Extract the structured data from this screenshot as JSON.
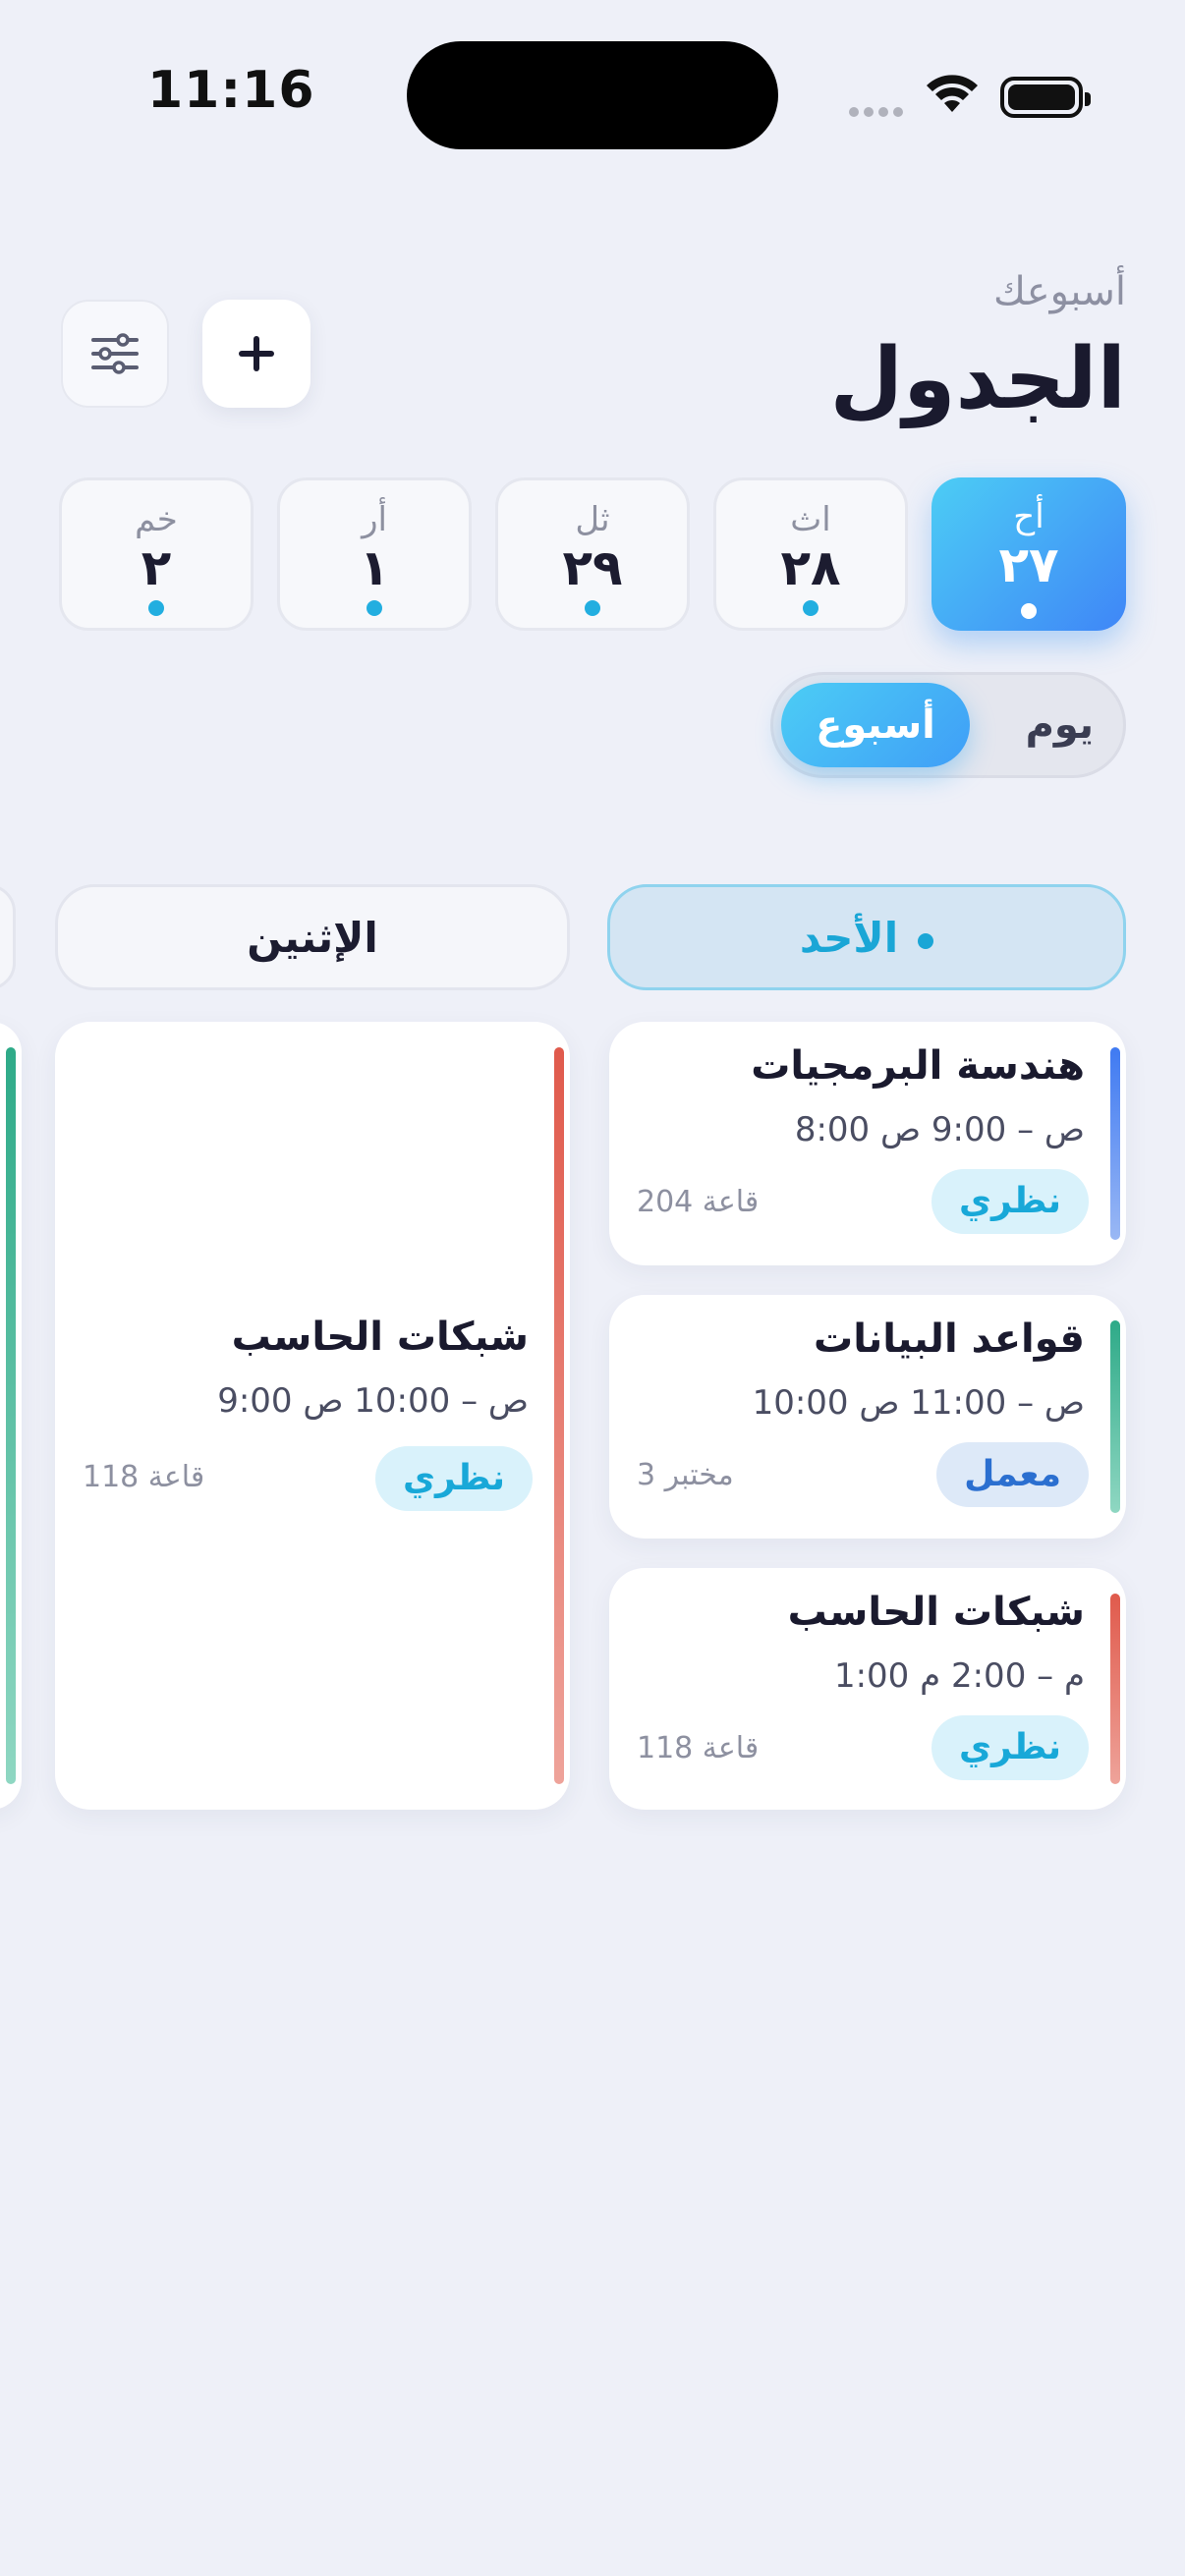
{
  "status_bar": {
    "time": "11:16"
  },
  "header": {
    "kicker": "أسبوعك",
    "title": "الجدول"
  },
  "day_chips": [
    {
      "name": "أح",
      "date": "٢٧",
      "active": true
    },
    {
      "name": "اث",
      "date": "٢٨",
      "active": false
    },
    {
      "name": "ثل",
      "date": "٢٩",
      "active": false
    },
    {
      "name": "أر",
      "date": "١",
      "active": false
    },
    {
      "name": "خم",
      "date": "٢",
      "active": false
    }
  ],
  "view_toggle": {
    "day": "يوم",
    "week": "أسبوع",
    "selected": "week"
  },
  "columns": {
    "sunday": {
      "label": "الأحد"
    },
    "monday": {
      "label": "الإثنين"
    }
  },
  "cards": {
    "sun1": {
      "title": "هندسة البرمجيات",
      "time": "8:00 ص – 9:00 ص",
      "tag": "نظري",
      "room": "قاعة 204"
    },
    "sun2": {
      "title": "قواعد البيانات",
      "time": "10:00 ص – 11:00 ص",
      "tag": "معمل",
      "room": "مختبر 3"
    },
    "sun3": {
      "title": "شبكات الحاسب",
      "time": "1:00 م – 2:00 م",
      "tag": "نظري",
      "room": "قاعة 118"
    },
    "mon1": {
      "title": "شبكات الحاسب",
      "time": "9:00 ص – 10:00 ص",
      "tag": "نظري",
      "room": "قاعة 118"
    }
  },
  "colors": {
    "accent_start": "#4ccdf5",
    "accent_end": "#3f86f7",
    "background": "#eef0f8"
  }
}
